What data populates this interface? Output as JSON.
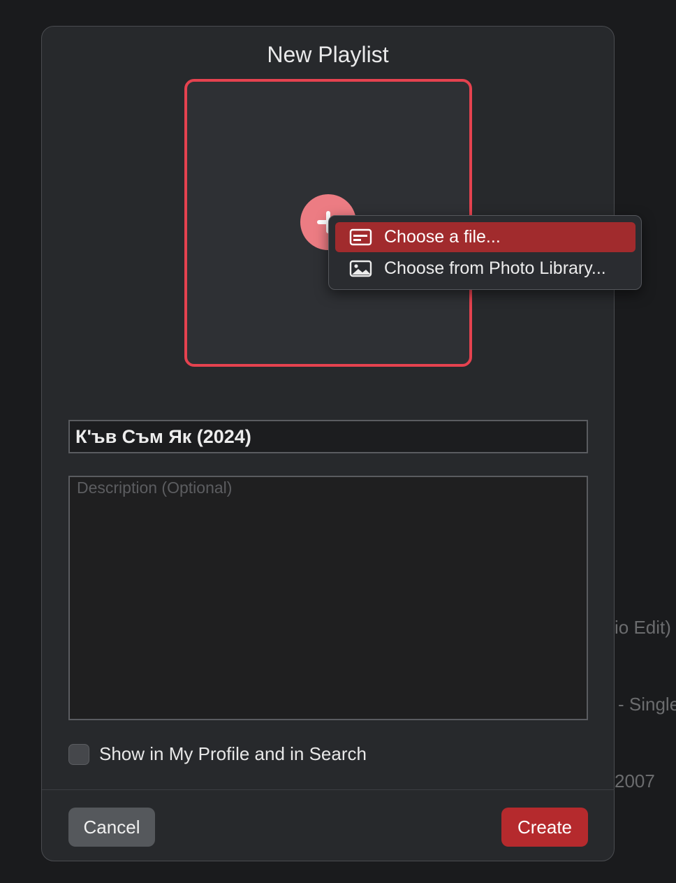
{
  "background": {
    "line1": "io Edit)",
    "line2": "- Single",
    "line3": "2007"
  },
  "dialog": {
    "title": "New Playlist",
    "artwork": {
      "add_icon": "plus-icon"
    },
    "artwork_menu": {
      "items": [
        {
          "label": "Choose a file...",
          "icon": "file-icon",
          "selected": true
        },
        {
          "label": "Choose from Photo Library...",
          "icon": "photo-icon",
          "selected": false
        }
      ]
    },
    "name_field": {
      "value": "К'ъв Съм Як (2024)"
    },
    "description_field": {
      "placeholder": "Description (Optional)",
      "value": ""
    },
    "show_in_profile": {
      "label": "Show in My Profile and in Search",
      "checked": false
    },
    "buttons": {
      "cancel": "Cancel",
      "create": "Create"
    }
  },
  "colors": {
    "accent": "#e5424f",
    "menu_selected": "#a12b2d",
    "create_button": "#b52a2d"
  }
}
